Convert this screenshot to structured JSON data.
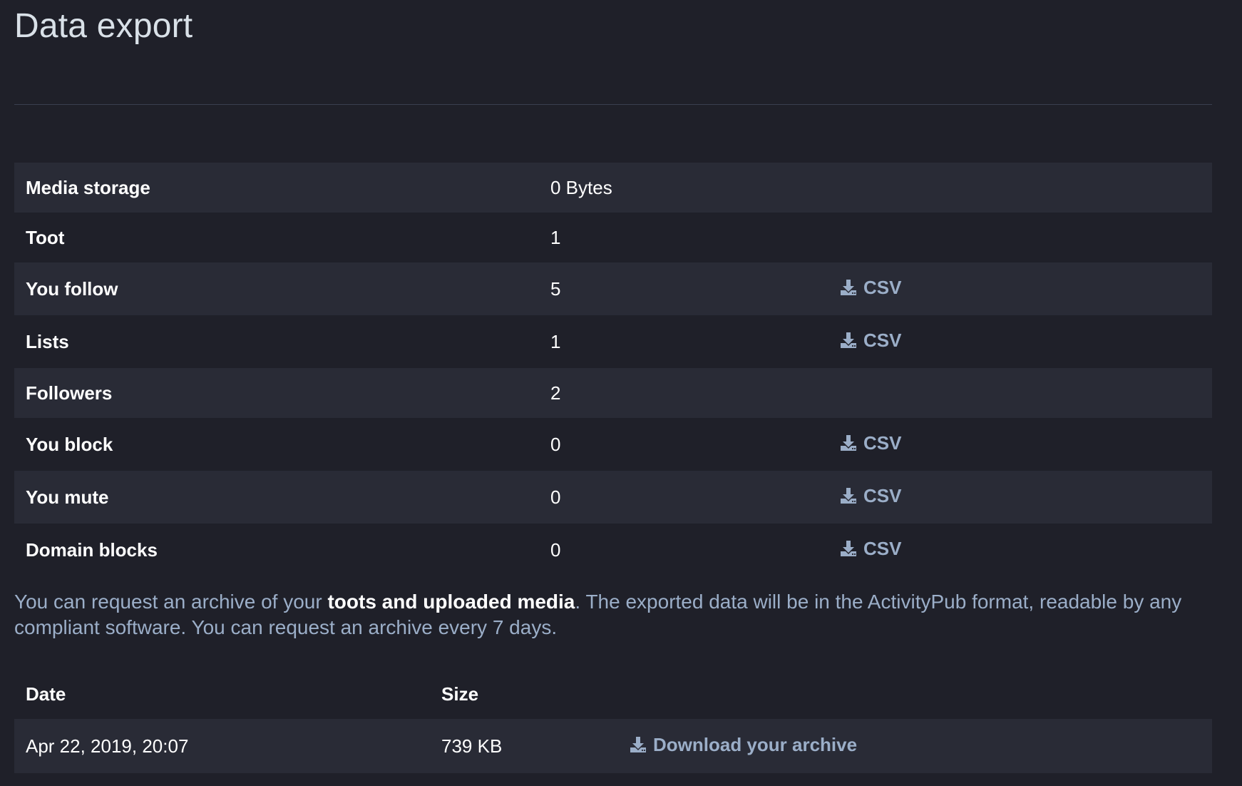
{
  "page": {
    "title": "Data export"
  },
  "stats": {
    "rows": [
      {
        "label": "Media storage",
        "value": "0 Bytes",
        "action": ""
      },
      {
        "label": "Toot",
        "value": "1",
        "action": ""
      },
      {
        "label": "You follow",
        "value": "5",
        "action": "CSV"
      },
      {
        "label": "Lists",
        "value": "1",
        "action": "CSV"
      },
      {
        "label": "Followers",
        "value": "2",
        "action": ""
      },
      {
        "label": "You block",
        "value": "0",
        "action": "CSV"
      },
      {
        "label": "You mute",
        "value": "0",
        "action": "CSV"
      },
      {
        "label": "Domain blocks",
        "value": "0",
        "action": "CSV"
      }
    ]
  },
  "description": {
    "before": "You can request an archive of your ",
    "bold": "toots and uploaded media",
    "after": ". The exported data will be in the ActivityPub format, readable by any compliant software. You can request an archive every 7 days."
  },
  "archive": {
    "headers": {
      "date": "Date",
      "size": "Size"
    },
    "row": {
      "date": "Apr 22, 2019, 20:07",
      "size": "739 KB",
      "link": "Download your archive"
    }
  },
  "colors": {
    "background": "#1f2029",
    "row_stripe": "#292b36",
    "link": "#9baec8",
    "title": "#d9e1e8"
  },
  "icons": {
    "csv": "download-icon",
    "archive": "download-icon"
  }
}
